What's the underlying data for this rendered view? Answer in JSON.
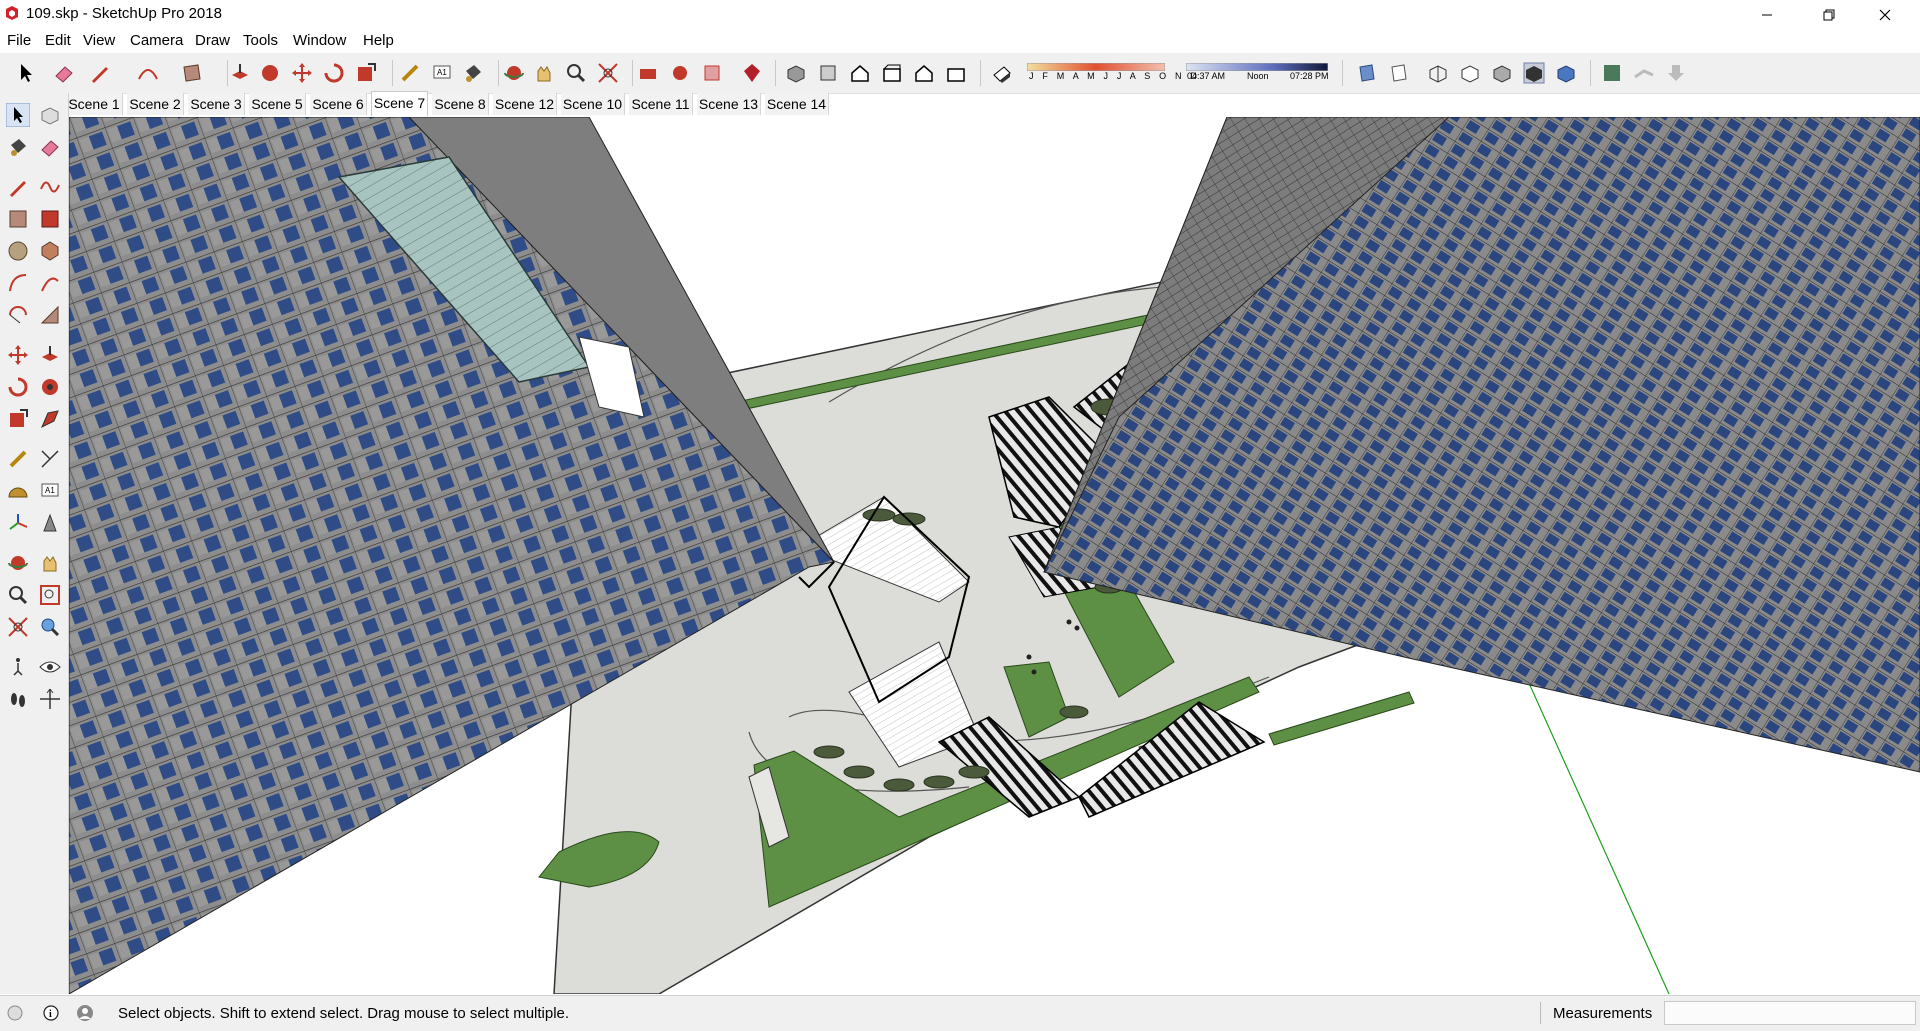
{
  "window": {
    "title": "109.skp - SketchUp Pro 2018",
    "icon": "sketchup-logo-icon"
  },
  "window_controls": [
    "minimize-icon",
    "restore-icon",
    "close-icon"
  ],
  "menu": [
    "File",
    "Edit",
    "View",
    "Camera",
    "Draw",
    "Tools",
    "Window",
    "Help"
  ],
  "toolbar": {
    "shadow_months": "J F M A M J J A S O N D",
    "time_start": "04:37 AM",
    "time_mid": "Noon",
    "time_end": "07:28 PM"
  },
  "scenes": {
    "tabs": [
      "Scene 1",
      "Scene 2",
      "Scene 3",
      "Scene 5",
      "Scene 6",
      "Scene 7",
      "Scene 8",
      "Scene 12",
      "Scene 10",
      "Scene 11",
      "Scene 13",
      "Scene 14"
    ],
    "active": "Scene 7"
  },
  "status": {
    "hint": "Select objects. Shift to extend select. Drag mouse to select multiple.",
    "measurements_label": "Measurements",
    "measurements_value": ""
  },
  "colors": {
    "glass_blue": "#2c4a82",
    "panel_gray": "#8a8a8a",
    "grass_green": "#5d8f45",
    "ground_gray": "#dcdcd8",
    "axis_green": "#1ea01e"
  }
}
